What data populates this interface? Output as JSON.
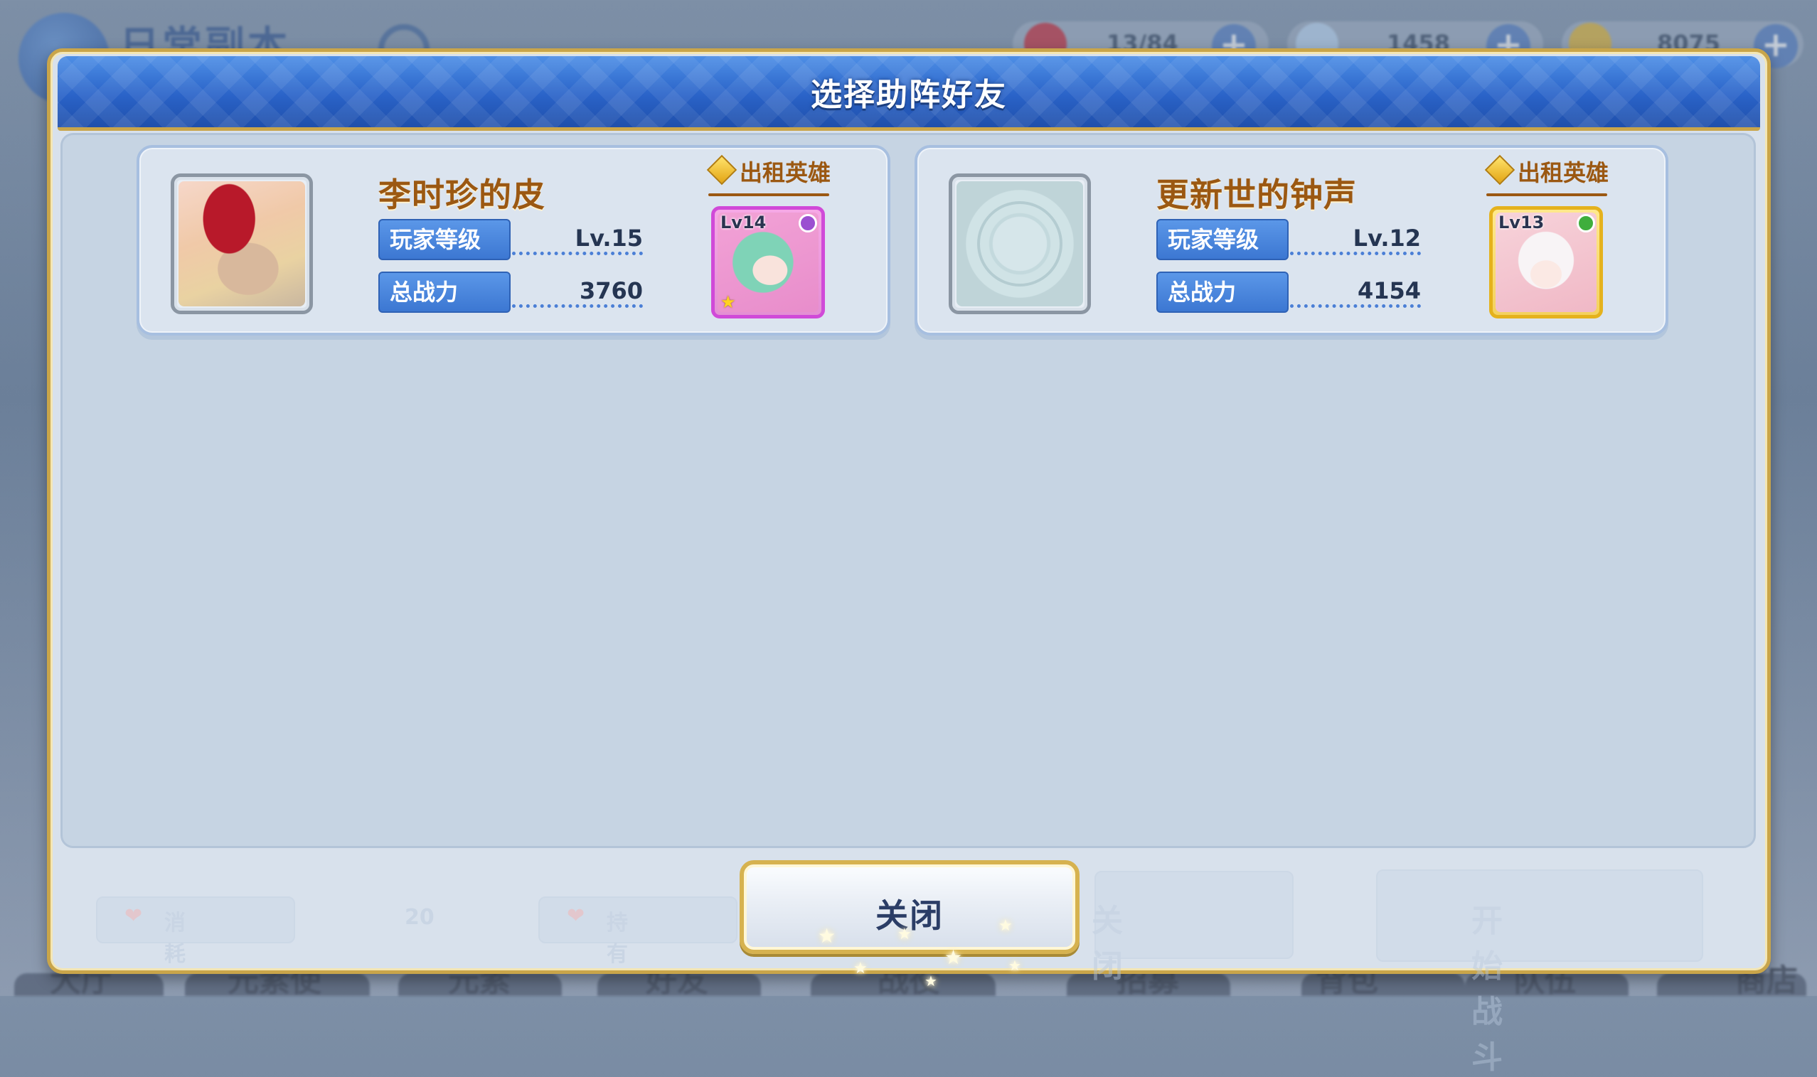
{
  "background": {
    "title": "日常副本",
    "resources": [
      {
        "name": "stamina",
        "value": "13/84",
        "icon": "heart-icon"
      },
      {
        "name": "crystal",
        "value": "1458",
        "icon": "crystal-icon"
      },
      {
        "name": "gold",
        "value": "8075",
        "icon": "coin-icon"
      }
    ],
    "bottom_tabs": [
      "大厅",
      "元素使",
      "元素",
      "好友",
      "战役",
      "招募",
      "背包",
      "队伍",
      "商店"
    ],
    "ghost_panel": {
      "consume_label": "消耗",
      "consume_value": "20",
      "own_label": "持有",
      "close_label": "关闭",
      "start_label": "开始战斗"
    }
  },
  "dialog": {
    "title": "选择助阵好友",
    "close_label": "关闭"
  },
  "friends": [
    {
      "name": "李时珍的皮",
      "level_label": "玩家等级",
      "level_value": "Lv.15",
      "power_label": "总战力",
      "power_value": "3760",
      "rent_label": "出租英雄",
      "hero_level": "Lv14",
      "hero_rarity_color": "#d04ad8"
    },
    {
      "name": "更新世的钟声",
      "level_label": "玩家等级",
      "level_value": "Lv.12",
      "power_label": "总战力",
      "power_value": "4154",
      "rent_label": "出租英雄",
      "hero_level": "Lv13",
      "hero_rarity_color": "#e5b21d"
    }
  ]
}
